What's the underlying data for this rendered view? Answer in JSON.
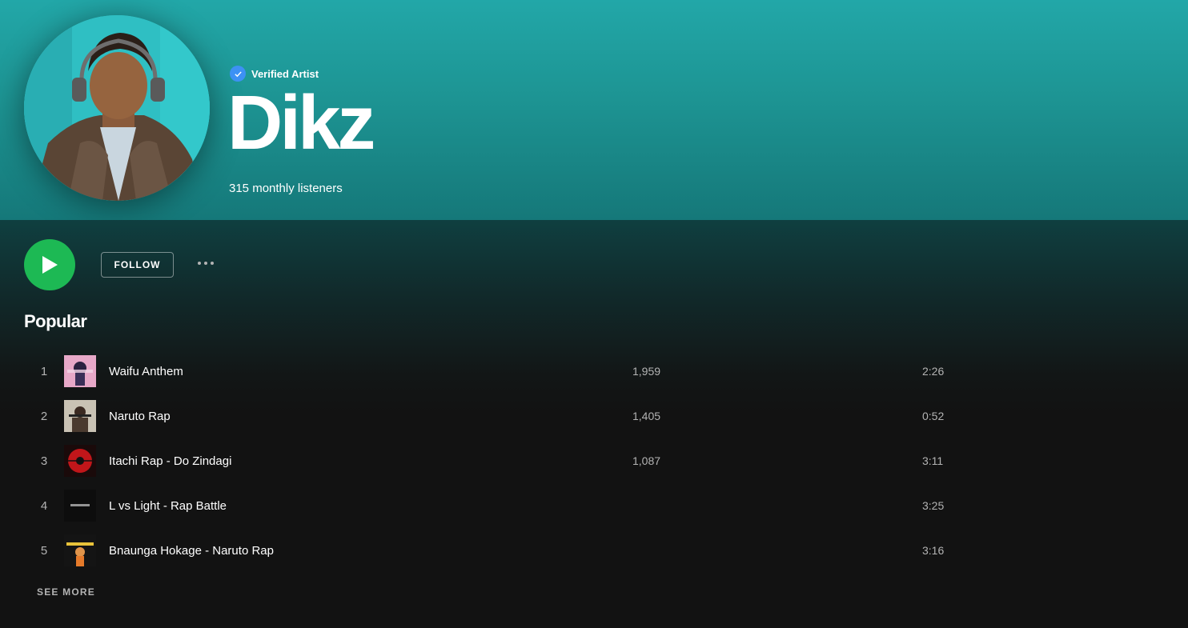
{
  "artist": {
    "verified_label": "Verified Artist",
    "name": "Dikz",
    "monthly_listeners": "315 monthly listeners"
  },
  "actions": {
    "follow_label": "FOLLOW"
  },
  "popular": {
    "title": "Popular",
    "see_more_label": "SEE MORE",
    "tracks": [
      {
        "rank": "1",
        "title": "Waifu Anthem",
        "plays": "1,959",
        "duration": "2:26"
      },
      {
        "rank": "2",
        "title": "Naruto Rap",
        "plays": "1,405",
        "duration": "0:52"
      },
      {
        "rank": "3",
        "title": "Itachi Rap - Do Zindagi",
        "plays": "1,087",
        "duration": "3:11"
      },
      {
        "rank": "4",
        "title": "L vs Light - Rap Battle",
        "plays": "",
        "duration": "3:25"
      },
      {
        "rank": "5",
        "title": "Bnaunga Hokage - Naruto Rap",
        "plays": "",
        "duration": "3:16"
      }
    ]
  },
  "colors": {
    "header_teal": "#22a7a8",
    "play_green": "#1db954",
    "verified_blue": "#3d91f4",
    "background": "#121212"
  }
}
